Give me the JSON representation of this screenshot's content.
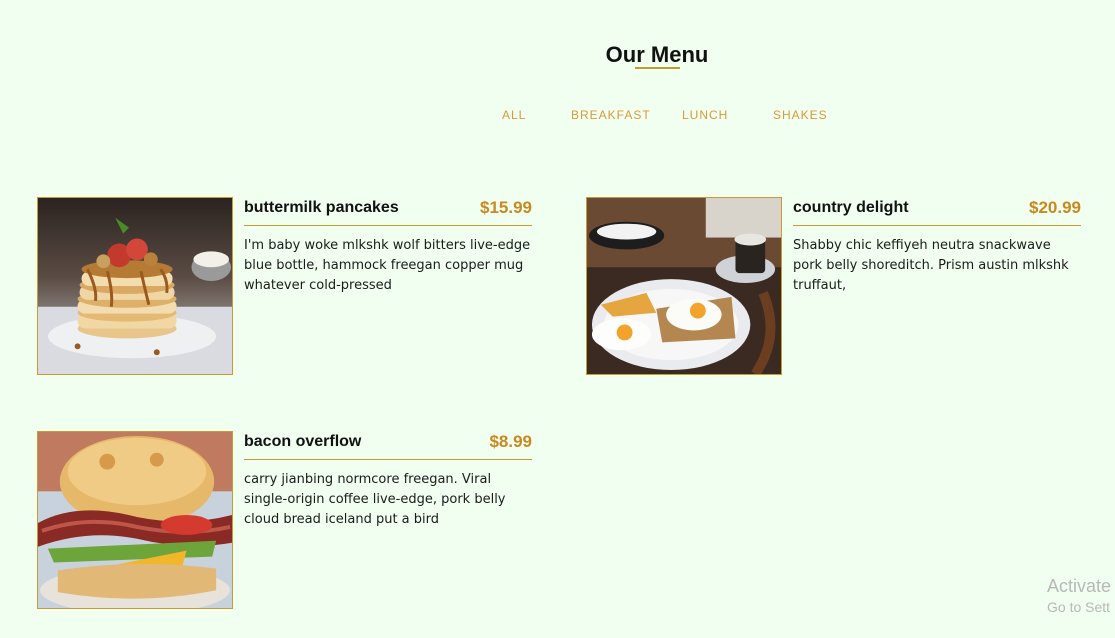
{
  "page": {
    "title": "Our Menu"
  },
  "filters": [
    "ALL",
    "BREAKFAST",
    "LUNCH",
    "SHAKES"
  ],
  "menu": [
    {
      "name": "buttermilk pancakes",
      "price": "$15.99",
      "description": "I'm baby woke mlkshk wolf bitters live-edge blue bottle, hammock freegan copper mug whatever cold-pressed",
      "image": "pancakes-photo"
    },
    {
      "name": "country delight",
      "price": "$20.99",
      "description": "Shabby chic keffiyeh neutra snackwave pork belly shoreditch. Prism austin mlkshk truffaut,",
      "image": "eggs-breakfast-photo"
    },
    {
      "name": "bacon overflow",
      "price": "$8.99",
      "description": "carry jianbing normcore freegan. Viral single-origin coffee live-edge, pork belly cloud bread iceland put a bird",
      "image": "bacon-sandwich-photo"
    }
  ],
  "watermark": {
    "line1": "Activate",
    "line2": "Go to Sett"
  },
  "colors": {
    "background": "#f0fff0",
    "accent": "#c59d2f",
    "price": "#c9891f",
    "tab": "#d89a3a"
  }
}
